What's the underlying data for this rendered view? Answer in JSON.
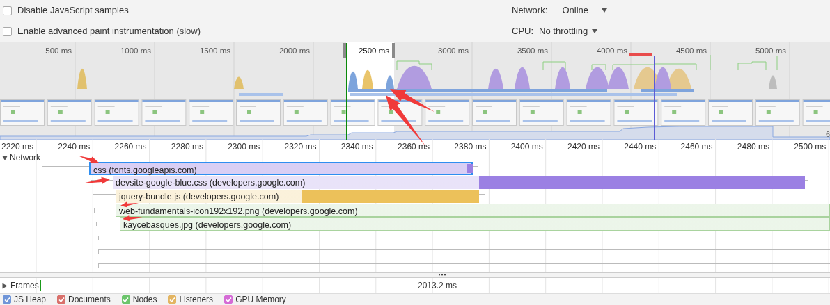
{
  "settings": {
    "checkboxes": [
      {
        "label": "Disable JavaScript samples",
        "checked": false
      },
      {
        "label": "Enable advanced paint instrumentation (slow)",
        "checked": false
      }
    ],
    "network": {
      "label": "Network:",
      "value": "Online"
    },
    "cpu": {
      "label": "CPU:",
      "value": "No throttling"
    }
  },
  "overview": {
    "ticks": [
      "500 ms",
      "1000 ms",
      "1500 ms",
      "2000 ms",
      "2500 ms",
      "3000 ms",
      "3500 ms",
      "4000 ms",
      "4500 ms",
      "5000 ms"
    ],
    "memory_label": "6"
  },
  "timeline": {
    "ticks": [
      "2220 ms",
      "2240 ms",
      "2260 ms",
      "2280 ms",
      "2300 ms",
      "2320 ms",
      "2340 ms",
      "2360 ms",
      "2380 ms",
      "2400 ms",
      "2420 ms",
      "2440 ms",
      "2460 ms",
      "2480 ms",
      "2500 ms"
    ]
  },
  "network": {
    "title": "Network",
    "expanded": true,
    "requests": [
      {
        "name": "css (fonts.googleapis.com)",
        "color": "#9b80e3",
        "selected": true
      },
      {
        "name": "devsite-google-blue.css (developers.google.com)",
        "color": "#9b80e3",
        "selected": false
      },
      {
        "name": "jquery-bundle.js (developers.google.com)",
        "color": "#ecc15a",
        "selected": false
      },
      {
        "name": "web-fundamentals-icon192x192.png (developers.google.com)",
        "color": "#a9d39e",
        "selected": false
      },
      {
        "name": "kaycebasques.jpg (developers.google.com)",
        "color": "#a9d39e",
        "selected": false
      }
    ]
  },
  "frames": {
    "title": "Frames",
    "expanded": false,
    "duration": "2013.2 ms"
  },
  "counters": [
    {
      "label": "JS Heap",
      "checked": true,
      "color": "#6f95d8"
    },
    {
      "label": "Documents",
      "checked": true,
      "color": "#d9706b"
    },
    {
      "label": "Nodes",
      "checked": true,
      "color": "#6cc56c"
    },
    {
      "label": "Listeners",
      "checked": true,
      "color": "#e3b562"
    },
    {
      "label": "GPU Memory",
      "checked": true,
      "color": "#d56bd6"
    }
  ]
}
